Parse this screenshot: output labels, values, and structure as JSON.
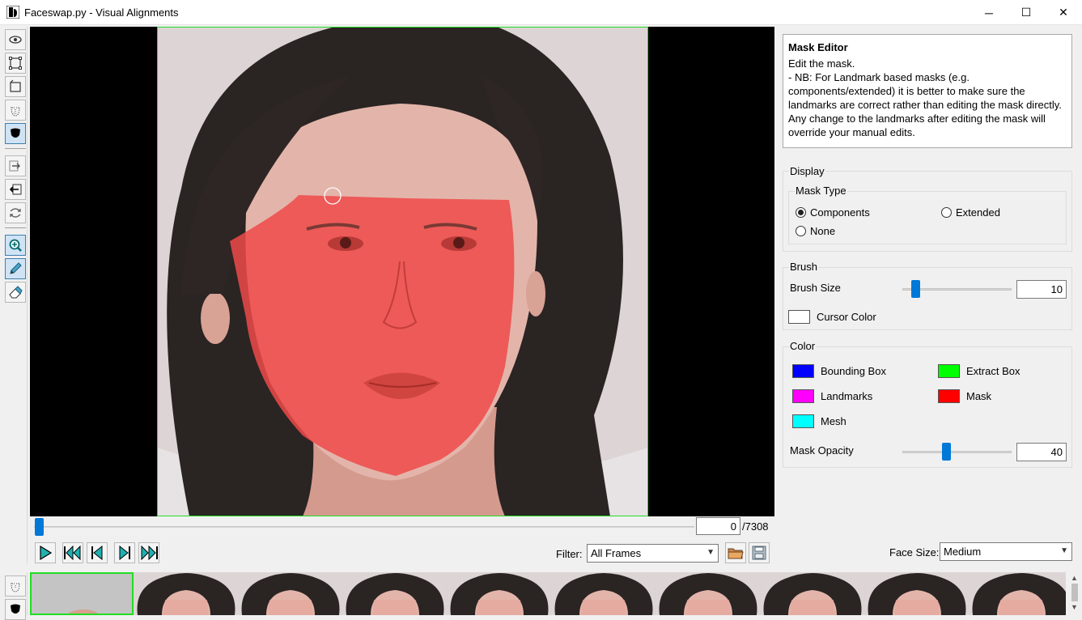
{
  "window": {
    "title": "Faceswap.py - Visual Alignments",
    "minimize": "─",
    "maximize": "☐",
    "close": "✕"
  },
  "toolbar": {
    "tools": [
      {
        "name": "view-icon",
        "active": false
      },
      {
        "name": "bounding-box-icon",
        "active": false
      },
      {
        "name": "extract-box-icon",
        "active": false
      },
      {
        "name": "landmarks-icon",
        "active": false
      },
      {
        "name": "mask-icon",
        "active": true
      },
      {
        "name": "copy-prev-icon",
        "active": false
      },
      {
        "name": "copy-next-icon",
        "active": false
      },
      {
        "name": "revert-icon",
        "active": false
      },
      {
        "name": "zoom-icon",
        "active": true
      },
      {
        "name": "draw-icon",
        "active": true
      },
      {
        "name": "erase-icon",
        "active": false
      }
    ]
  },
  "navigation": {
    "frame_value": "0",
    "frame_total": "/7308",
    "frame_progress": 0,
    "filter_label": "Filter:",
    "filter_value": "All Frames",
    "face_size_label": "Face Size:",
    "face_size_value": "Medium"
  },
  "help": {
    "title": "Mask Editor",
    "subtitle": "Edit the mask.",
    "note": " - NB: For Landmark based masks (e.g. components/extended) it is better to make sure the landmarks are correct rather than editing the mask directly. Any change to the landmarks after editing the mask will override your manual edits."
  },
  "display": {
    "group_label": "Display",
    "mask_type_label": "Mask Type",
    "options": [
      {
        "label": "Components",
        "selected": true
      },
      {
        "label": "Extended",
        "selected": false
      },
      {
        "label": "None",
        "selected": false
      }
    ]
  },
  "brush": {
    "group_label": "Brush",
    "size_label": "Brush Size",
    "size_value": "10",
    "cursor_color_label": "Cursor Color",
    "cursor_color": "#ffffff"
  },
  "color": {
    "group_label": "Color",
    "items": [
      {
        "label": "Bounding Box",
        "color": "#0000ff"
      },
      {
        "label": "Extract Box",
        "color": "#00ff00"
      },
      {
        "label": "Landmarks",
        "color": "#ff00ff"
      },
      {
        "label": "Mask",
        "color": "#ff0000"
      },
      {
        "label": "Mesh",
        "color": "#00ffff"
      }
    ],
    "opacity_label": "Mask Opacity",
    "opacity_value": "40"
  },
  "filmstrip": {
    "thumb_count": 10
  }
}
